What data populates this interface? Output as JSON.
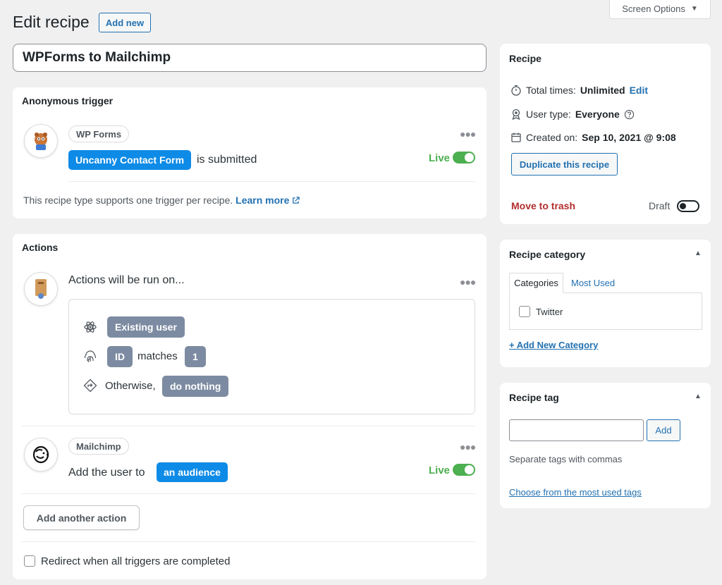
{
  "header": {
    "title": "Edit recipe",
    "add_new_label": "Add new",
    "screen_options_label": "Screen Options"
  },
  "recipe_title": "WPForms to Mailchimp",
  "trigger": {
    "section_label": "Anonymous trigger",
    "integration": "WP Forms",
    "token": "Uncanny Contact Form",
    "sentence_suffix": "is submitted",
    "status": "Live",
    "note": "This recipe type supports one trigger per recipe.",
    "learn_more": "Learn more"
  },
  "actions": {
    "section_label": "Actions",
    "run_on_label": "Actions will be run on...",
    "existing_user": "Existing user",
    "id_token": "ID",
    "matches_text": "matches",
    "match_value": "1",
    "otherwise_text": "Otherwise,",
    "otherwise_token": "do nothing",
    "action_integration": "Mailchimp",
    "action_prefix": "Add the user to",
    "action_token": "an audience",
    "action_status": "Live",
    "add_action_label": "Add another action",
    "redirect_label": "Redirect when all triggers are completed"
  },
  "sidebar": {
    "recipe": {
      "title": "Recipe",
      "total_times_label": "Total times:",
      "total_times_value": "Unlimited",
      "edit_link": "Edit",
      "user_type_label": "User type:",
      "user_type_value": "Everyone",
      "created_label": "Created on:",
      "created_value": "Sep 10, 2021 @ 9:08",
      "duplicate_label": "Duplicate this recipe",
      "trash_label": "Move to trash",
      "draft_label": "Draft"
    },
    "category": {
      "title": "Recipe category",
      "tab_categories": "Categories",
      "tab_most_used": "Most Used",
      "item_twitter": "Twitter",
      "add_new_category": "+ Add New Category"
    },
    "tag": {
      "title": "Recipe tag",
      "add_label": "Add",
      "hint": "Separate tags with commas",
      "choose_link": "Choose from the most used tags"
    }
  },
  "colors": {
    "accent_blue": "#0e8be7",
    "link_blue": "#2271b1",
    "live_green": "#4caf50",
    "trash_red": "#b32d2e",
    "token_grey": "#7c8ba1"
  }
}
